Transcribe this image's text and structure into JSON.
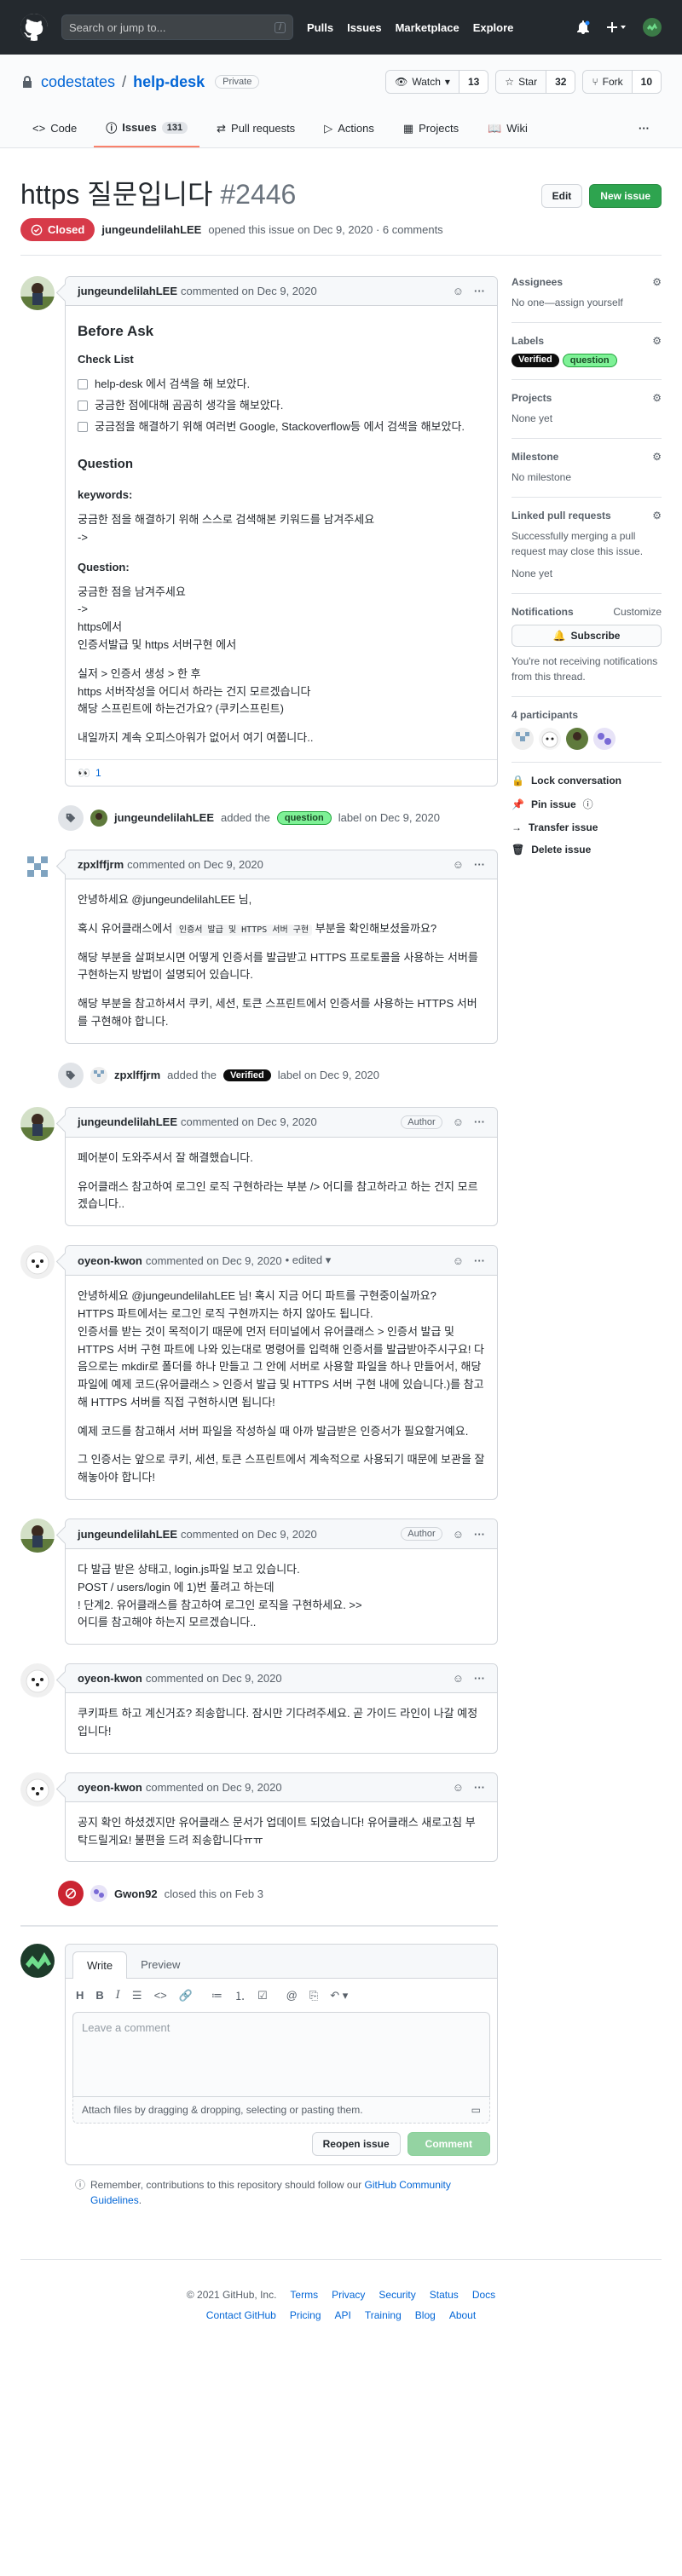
{
  "header": {
    "search_placeholder": "Search or jump to...",
    "slash": "/",
    "nav": [
      "Pulls",
      "Issues",
      "Marketplace",
      "Explore"
    ]
  },
  "repo": {
    "owner": "codestates",
    "sep": "/",
    "name": "help-desk",
    "visibility": "Private",
    "watch_label": "Watch",
    "watch_count": "13",
    "star_label": "Star",
    "star_count": "32",
    "fork_label": "Fork",
    "fork_count": "10",
    "tabs": [
      {
        "label": "Code"
      },
      {
        "label": "Issues",
        "count": "131"
      },
      {
        "label": "Pull requests"
      },
      {
        "label": "Actions"
      },
      {
        "label": "Projects"
      },
      {
        "label": "Wiki"
      }
    ]
  },
  "issue": {
    "title": "https 질문입니다",
    "number": "#2446",
    "edit_label": "Edit",
    "new_issue_label": "New issue",
    "state": "Closed",
    "author": "jungeundelilahLEE",
    "meta": "opened this issue on Dec 9, 2020 · 6 comments"
  },
  "comments": [
    {
      "author": "jungeundelilahLEE",
      "when": "commented on Dec 9, 2020",
      "h_before": "Before Ask",
      "h_check": "Check List",
      "checks": [
        "help-desk 에서 검색을 해 보았다.",
        "궁금한 점에대해 곰곰히 생각을 해보았다.",
        "궁금점을 해결하기 위해 여러번 Google, Stackoverflow등 에서 검색을 해보았다."
      ],
      "h_question": "Question",
      "h_keywords": "keywords:",
      "kw1": "궁금한 점을 해결하기 위해 스스로 검색해본 키워드를 남겨주세요",
      "kw2": "->",
      "h_q": "Question:",
      "q1": "궁금한 점을 남겨주세요",
      "q2": "->",
      "q3": "https에서",
      "q4": "인증서발급 및 https 서버구현 에서",
      "q5": "실저 > 인증서 생성 > 한 후",
      "q6": "https 서버작성을 어디서 하라는 건지 모르겠습니다",
      "q7": "해당 스프린트에 하는건가요? (쿠키스프린트)",
      "q8": "내일까지 계속 오피스아워가 없어서 여기 여쭙니다..",
      "reaction": "👀",
      "reaction_count": "1"
    },
    {
      "author": "zpxlffjrm",
      "when": "commented on Dec 9, 2020",
      "p1": "안녕하세요 @jungeundelilahLEE 님,",
      "p2a": "혹시 유어클래스에서",
      "p2code": "인증서 발급 및 HTTPS 서버 구현",
      "p2b": "부분을 확인해보셨을까요?",
      "p3": "해당 부분을 살펴보시면 어떻게 인증서를 발급받고 HTTPS 프로토콜을 사용하는 서버를 구현하는지 방법이 설명되어 있습니다.",
      "p4": "해당 부분을 참고하셔서 쿠키, 세션, 토큰 스프린트에서 인증서를 사용하는 HTTPS 서버를 구현해야 합니다."
    },
    {
      "author": "jungeundelilahLEE",
      "when": "commented on Dec 9, 2020",
      "badge": "Author",
      "p1": "페어분이 도와주셔서 잘 해결했습니다.",
      "p2": "유어클래스 참고하여 로그인 로직 구현하라는 부분 /> 어디를 참고하라고 하는 건지 모르겠습니다.."
    },
    {
      "author": "oyeon-kwon",
      "when": "commented on Dec 9, 2020",
      "edited": "• edited ▾",
      "p1": "안녕하세요 @jungeundelilahLEE 님! 혹시 지금 어디 파트를 구현중이실까요?",
      "p2": "HTTPS 파트에서는 로그인 로직 구현까지는 하지 않아도 됩니다.",
      "p3": "인증서를 받는 것이 목적이기 때문에 먼저 터미널에서 유어클래스 > 인증서 발급 및 HTTPS 서버 구현 파트에 나와 있는대로 명령어를 입력해 인증서를 발급받아주시구요! 다음으로는 mkdir로 폴더를 하나 만들고 그 안에 서버로 사용할 파일을 하나 만들어서, 해당 파일에 예제 코드(유어클래스 > 인증서 발급 및 HTTPS 서버 구현 내에 있습니다.)를 참고해 HTTPS 서버를 직접 구현하시면 됩니다!",
      "p4": "예제 코드를 참고해서 서버 파일을 작성하실 때 아까 발급받은 인증서가 필요할거예요.",
      "p5": "그 인증서는 앞으로 쿠키, 세션, 토큰 스프린트에서 계속적으로 사용되기 때문에 보관을 잘 해놓아야 합니다!"
    },
    {
      "author": "jungeundelilahLEE",
      "when": "commented on Dec 9, 2020",
      "badge": "Author",
      "p1": "다 발급 받은 상태고, login.js파일 보고 있습니다.",
      "p2": "POST / users/login 에 1)번 풀려고 하는데",
      "p3": "! 단계2. 유어클래스를 참고하여 로그인 로직을 구현하세요. >>",
      "p4": "어디를 참고해야 하는지 모르겠습니다.."
    },
    {
      "author": "oyeon-kwon",
      "when": "commented on Dec 9, 2020",
      "p1": "쿠키파트 하고 계신거죠? 죄송합니다. 잠시만 기다려주세요. 곧 가이드 라인이 나갈 예정입니다!"
    },
    {
      "author": "oyeon-kwon",
      "when": "commented on Dec 9, 2020",
      "p1": "공지 확인 하셨겠지만 유어클래스 문서가 업데이트 되었습니다! 유어클래스 새로고침 부탁드릴게요! 불편을 드려 죄송합니다ㅠㅠ"
    }
  ],
  "events": {
    "label1_actor": "jungeundelilahLEE",
    "label1_pre": "added the",
    "label1_name": "question",
    "label1_post": "label on Dec 9, 2020",
    "label2_actor": "zpxlffjrm",
    "label2_pre": "added the",
    "label2_name": "Verified",
    "label2_post": "label on Dec 9, 2020",
    "closed_actor": "Gwon92",
    "closed_text": "closed this on Feb 3"
  },
  "new_comment": {
    "tab_write": "Write",
    "tab_preview": "Preview",
    "placeholder": "Leave a comment",
    "attach": "Attach files by dragging & dropping, selecting or pasting them.",
    "reopen": "Reopen issue",
    "comment": "Comment",
    "remember_pre": "Remember, contributions to this repository should follow our",
    "remember_link": "GitHub Community Guidelines",
    "remember_post": "."
  },
  "sidebar": {
    "assignees_h": "Assignees",
    "assignees_v": "No one—assign yourself",
    "labels_h": "Labels",
    "label_verified": "Verified",
    "label_question": "question",
    "projects_h": "Projects",
    "projects_v": "None yet",
    "milestone_h": "Milestone",
    "milestone_v": "No milestone",
    "linked_h": "Linked pull requests",
    "linked_v1": "Successfully merging a pull request may close this issue.",
    "linked_v2": "None yet",
    "notif_h": "Notifications",
    "notif_customize": "Customize",
    "subscribe": "Subscribe",
    "notif_v": "You're not receiving notifications from this thread.",
    "participants_h": "4 participants",
    "lock": "Lock conversation",
    "pin": "Pin issue",
    "transfer": "Transfer issue",
    "delete": "Delete issue"
  },
  "footer": {
    "copyright": "© 2021 GitHub, Inc.",
    "row1": [
      "Terms",
      "Privacy",
      "Security",
      "Status",
      "Docs"
    ],
    "row2": [
      "Contact GitHub",
      "Pricing",
      "API",
      "Training",
      "Blog",
      "About"
    ]
  },
  "colors": {
    "closed": "#d73a49",
    "green": "#2ea44f",
    "link": "#0366d6",
    "label_question": "#7ef196",
    "label_verified": "#0d0d0d"
  }
}
